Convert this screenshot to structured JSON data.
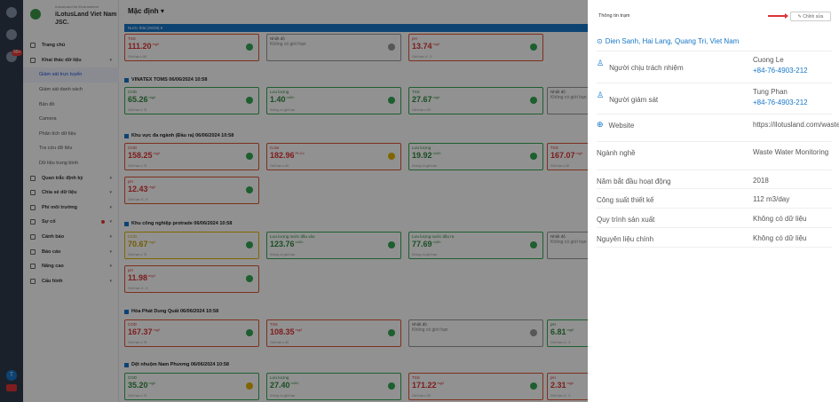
{
  "sidebar": {
    "tagline": "iLotusLand for Environment",
    "company": "iLotusLand Viet Nam JSC.",
    "badge": "99+",
    "items": [
      {
        "label": "Trang chủ",
        "kind": "group"
      },
      {
        "label": "Khai thác dữ liệu",
        "kind": "group"
      },
      {
        "label": "Giám sát trực tuyến",
        "kind": "sub-active"
      },
      {
        "label": "Giám sát danh sách",
        "kind": "sub"
      },
      {
        "label": "Bản đồ",
        "kind": "sub"
      },
      {
        "label": "Camera",
        "kind": "sub"
      },
      {
        "label": "Phân tích dữ liệu",
        "kind": "sub"
      },
      {
        "label": "Tra cứu dữ liệu",
        "kind": "sub"
      },
      {
        "label": "Dữ liệu trung bình",
        "kind": "sub"
      },
      {
        "label": "Quan trắc định kỳ",
        "kind": "group"
      },
      {
        "label": "Chia sẻ dữ liệu",
        "kind": "group"
      },
      {
        "label": "Phí môi trường",
        "kind": "group"
      },
      {
        "label": "Sự cố",
        "kind": "group"
      },
      {
        "label": "Cảnh báo",
        "kind": "group"
      },
      {
        "label": "Báo cáo",
        "kind": "group"
      },
      {
        "label": "Nâng cao",
        "kind": "group"
      },
      {
        "label": "Cấu hình",
        "kind": "group"
      }
    ],
    "profile_initial": "T"
  },
  "main": {
    "select_label": "Mặc định",
    "filter_label": "Nước thải (29/29)",
    "stations": [
      {
        "title": "VINATEX TOMS  06/06/2024 10:58"
      },
      {
        "title": "Khu vực đa ngành (Đầu ra)  06/06/2024 10:58"
      },
      {
        "title": "Khu công nghiệp protrade  06/06/2024 10:58"
      },
      {
        "title": "Hòa Phát Dung Quất  06/06/2024 10:58"
      },
      {
        "title": "Dệt nhuộm Nam Phương  06/06/2024 10:58"
      }
    ],
    "cards": [
      {
        "lbl": "TSS",
        "val": "111.20",
        "unit": "mg/l",
        "sub": "Giới hạn ≤ 50",
        "color": "red",
        "st": "green"
      },
      {
        "lbl": "Nhiệt độ",
        "val": "Không có giới hạn",
        "unit": "",
        "sub": "",
        "color": "grey",
        "st": "grey"
      },
      {
        "lbl": "pH",
        "val": "13.74",
        "unit": "mg/l",
        "sub": "Giới hạn: 5 - 9",
        "color": "red",
        "st": "green"
      },
      {
        "lbl": "COD",
        "val": "65.26",
        "unit": "mg/l",
        "sub": "Giới hạn ≤ 75",
        "color": "green",
        "st": "green"
      },
      {
        "lbl": "Lưu lượng",
        "val": "1.40",
        "unit": "m3/h",
        "sub": "Không có giới hạn",
        "color": "green",
        "st": "green"
      },
      {
        "lbl": "TSS",
        "val": "27.67",
        "unit": "mg/l",
        "sub": "Giới hạn ≤ 50",
        "color": "green",
        "st": "green"
      },
      {
        "lbl": "Nhiệt độ",
        "val": "Không có giới hạn",
        "unit": "",
        "sub": "",
        "color": "grey",
        "st": "grey"
      },
      {
        "lbl": "COD",
        "val": "158.25",
        "unit": "mg/l",
        "sub": "Giới hạn ≤ 75",
        "color": "red",
        "st": "green"
      },
      {
        "lbl": "Color",
        "val": "182.96",
        "unit": "Pt-Co",
        "sub": "Giới hạn ≤ 50",
        "color": "red",
        "st": "yellow"
      },
      {
        "lbl": "Lưu lượng",
        "val": "19.92",
        "unit": "m3/h",
        "sub": "Không có giới hạn",
        "color": "green",
        "st": "green"
      },
      {
        "lbl": "TSS",
        "val": "167.07",
        "unit": "mg/l",
        "sub": "Giới hạn ≤ 50",
        "color": "red",
        "st": "green"
      },
      {
        "lbl": "pH",
        "val": "12.43",
        "unit": "mg/l",
        "sub": "Giới hạn: 6 - 9",
        "color": "red",
        "st": "green"
      },
      {
        "lbl": "COD",
        "val": "70.67",
        "unit": "mg/l",
        "sub": "Giới hạn ≤ 75",
        "color": "yellow",
        "st": "green"
      },
      {
        "lbl": "Lưu lượng nước đầu vào",
        "val": "123.76",
        "unit": "m3/h",
        "sub": "Không có giới hạn",
        "color": "green",
        "st": "green"
      },
      {
        "lbl": "Lưu lượng nước đầu ra",
        "val": "77.69",
        "unit": "m3/h",
        "sub": "Không có giới hạn",
        "color": "green",
        "st": "green"
      },
      {
        "lbl": "Nhiệt độ",
        "val": "Không có giới hạn",
        "unit": "",
        "sub": "",
        "color": "grey",
        "st": "grey"
      },
      {
        "lbl": "pH",
        "val": "11.98",
        "unit": "mg/l",
        "sub": "Giới hạn: 6 - 9",
        "color": "red",
        "st": "green"
      },
      {
        "lbl": "COD",
        "val": "167.37",
        "unit": "mg/l",
        "sub": "Giới hạn ≤ 75",
        "color": "red",
        "st": "green"
      },
      {
        "lbl": "TSS",
        "val": "108.35",
        "unit": "mg/l",
        "sub": "Giới hạn ≤ 50",
        "color": "red",
        "st": "green"
      },
      {
        "lbl": "Nhiệt độ",
        "val": "Không có giới hạn",
        "unit": "",
        "sub": "",
        "color": "grey",
        "st": "grey"
      },
      {
        "lbl": "pH",
        "val": "6.81",
        "unit": "mg/l",
        "sub": "Giới hạn: 6 - 9",
        "color": "green",
        "st": "green"
      },
      {
        "lbl": "COD",
        "val": "35.20",
        "unit": "mg/l",
        "sub": "Giới hạn ≤ 75",
        "color": "green",
        "st": "yellow"
      },
      {
        "lbl": "Lưu lượng",
        "val": "27.40",
        "unit": "m3/h",
        "sub": "Không có giới hạn",
        "color": "green",
        "st": "green"
      },
      {
        "lbl": "TSS",
        "val": "171.22",
        "unit": "mg/l",
        "sub": "Giới hạn ≤ 50",
        "color": "red",
        "st": "green"
      },
      {
        "lbl": "pH",
        "val": "2.31",
        "unit": "mg/l",
        "sub": "Giới hạn: 6 - 9",
        "color": "red",
        "st": "green"
      }
    ]
  },
  "panel": {
    "title": "Thông tin trạm",
    "edit_label": "Chỉnh sửa",
    "address": "Dien Sanh, Hai Lang, Quang Tri, Viet Nam",
    "rows": [
      {
        "key": "Người chịu trách nhiệm",
        "value": "Cuong Le",
        "value2": "+84-76-4903-212",
        "icon": "user-icon"
      },
      {
        "key": "Người giám sát",
        "value": "Tung Phan",
        "value2": "+84-76-4903-212",
        "icon": "user-icon"
      },
      {
        "key": "Website",
        "value": "https://ilotusland.com/wastewater/",
        "value2": "",
        "icon": "globe-icon"
      },
      {
        "key": "Ngành nghề",
        "value": "Waste Water Monitoring",
        "value2": "",
        "icon": ""
      },
      {
        "key": "Năm bắt đầu hoạt động",
        "value": "2018",
        "value2": "",
        "icon": ""
      },
      {
        "key": "Công suất thiết kế",
        "value": "112 m3/day",
        "value2": "",
        "icon": ""
      },
      {
        "key": "Quy trình sản xuất",
        "value": "Không có dữ liệu",
        "value2": "",
        "icon": ""
      },
      {
        "key": "Nguyên liệu chính",
        "value": "Không có dữ liệu",
        "value2": "",
        "icon": ""
      }
    ]
  },
  "colors": {
    "accent": "#1677c8",
    "danger": "#d33333",
    "ok": "#34a853",
    "warn": "#e0b400",
    "rail": "#2f3a4c"
  }
}
